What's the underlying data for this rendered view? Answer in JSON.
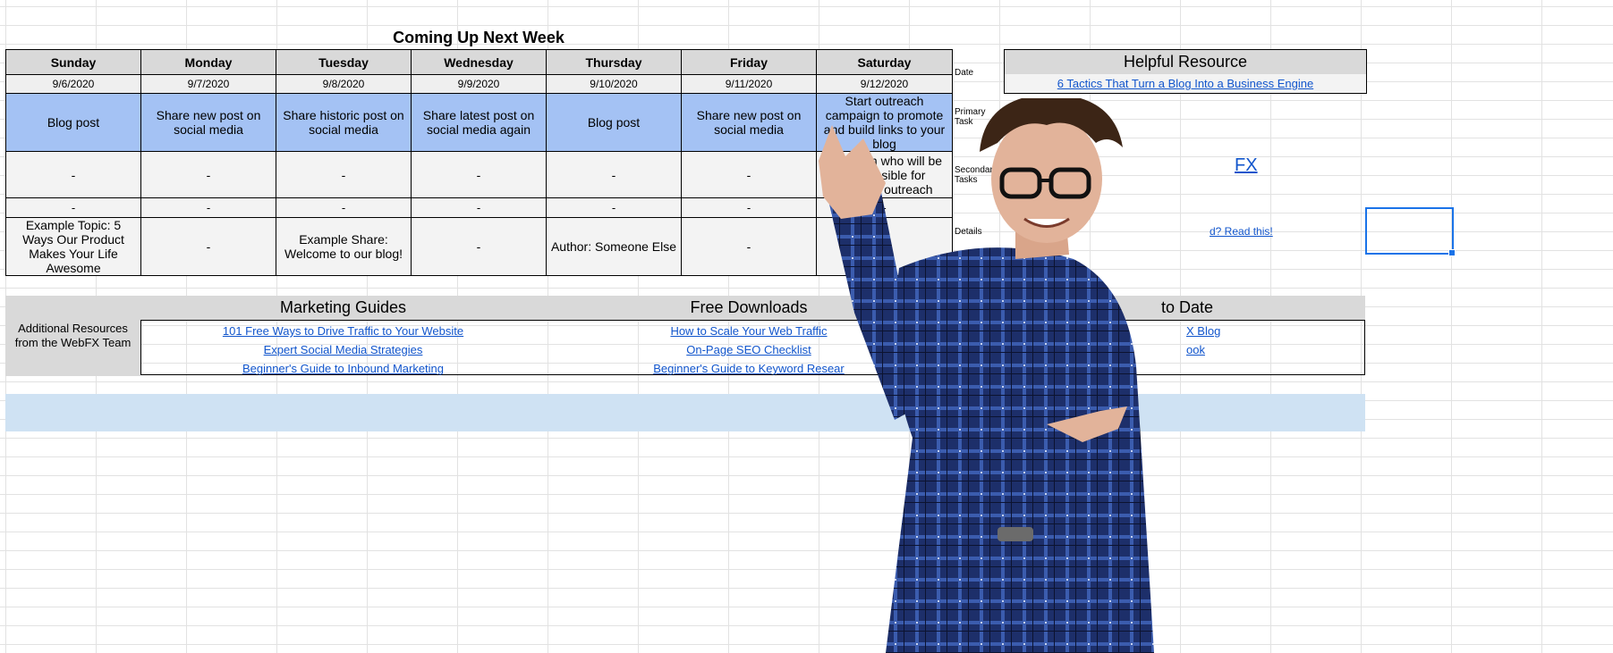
{
  "sheet": {
    "title": "Coming Up Next Week",
    "days": [
      "Sunday",
      "Monday",
      "Tuesday",
      "Wednesday",
      "Thursday",
      "Friday",
      "Saturday"
    ],
    "dates": [
      "9/6/2020",
      "9/7/2020",
      "9/8/2020",
      "9/9/2020",
      "9/10/2020",
      "9/11/2020",
      "9/12/2020"
    ],
    "primary": [
      "Blog post",
      "Share new post on social media",
      "Share historic post on social media",
      "Share latest post on social media again",
      "Blog post",
      "Share new post on social media",
      "Start outreach campaign to promote and build links to your blog"
    ],
    "secondary": [
      "-",
      "-",
      "-",
      "-",
      "-",
      "-",
      "Establish who will be responsible for ongoing outreach"
    ],
    "secondary2": [
      "-",
      "-",
      "-",
      "-",
      "-",
      "-",
      "-"
    ],
    "details": [
      "Example Topic: 5 Ways Our Product Makes Your Life Awesome",
      "-",
      "Example Share: Welcome to our blog!",
      "-",
      "Author: Someone Else",
      "-",
      "-"
    ],
    "row_labels": {
      "date": "Date",
      "primary": "Primary Task",
      "secondary": "Secondary Tasks",
      "details": "Details"
    }
  },
  "helpful": {
    "header": "Helpful Resource",
    "link": "6 Tactics That Turn a Blog Into a Business Engine",
    "fx_fragment": "FX",
    "read_fragment": "d? Read this!"
  },
  "additional": {
    "label": "Additional Resources from the WebFX Team",
    "marketing_guides": {
      "header": "Marketing Guides",
      "links": [
        "101 Free Ways to Drive Traffic to Your Website",
        "Expert Social Media Strategies",
        "Beginner's Guide to Inbound Marketing"
      ]
    },
    "free_downloads": {
      "header": "Free Downloads",
      "links": [
        "How to Scale Your Web Traffic",
        "On-Page SEO Checklist",
        "Beginner's Guide to Keyword Resear"
      ]
    },
    "stay": {
      "header": "to Date",
      "links": [
        "X Blog",
        "ook"
      ]
    }
  },
  "colors": {
    "primary_row": "#a4c2f4",
    "header_gray": "#d9d9d9",
    "link": "#1155cc",
    "banner": "#cfe2f3",
    "selection": "#1a73e8"
  }
}
